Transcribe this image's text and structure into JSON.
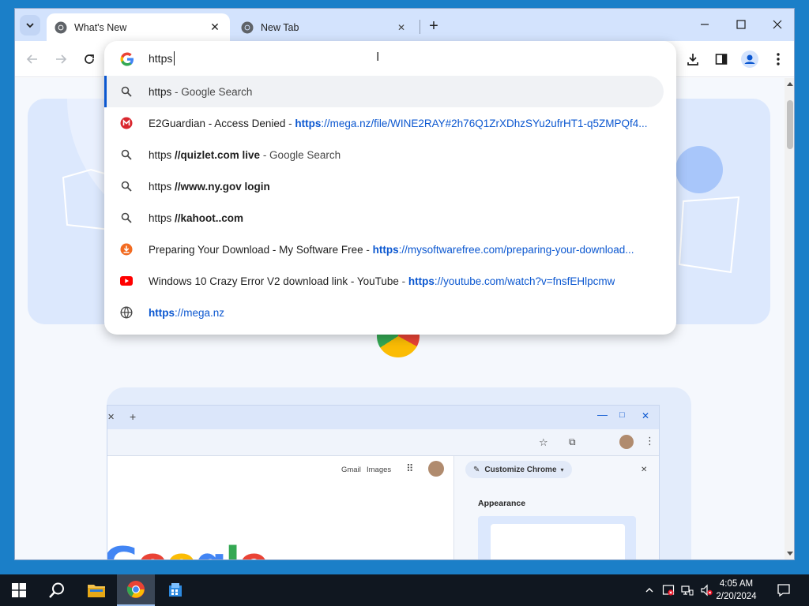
{
  "tabs": [
    {
      "title": "What's New",
      "active": true
    },
    {
      "title": "New Tab",
      "active": false
    }
  ],
  "omnibox": {
    "typed_text": "https",
    "suggestions": [
      {
        "icon": "search-icon",
        "parts": [
          {
            "t": "https",
            "c": ""
          },
          {
            "t": " - Google Search",
            "c": "dim"
          }
        ]
      },
      {
        "icon": "mega-favicon",
        "parts": [
          {
            "t": "E2Guardian - Access Denied",
            "c": ""
          },
          {
            "t": " - ",
            "c": "dim"
          },
          {
            "t": "https",
            "c": "url-b"
          },
          {
            "t": "://mega.nz/file/WINE2RAY#2h76Q1ZrXDhzSYu2ufrHT1-q5ZMPQf4...",
            "c": "url"
          }
        ]
      },
      {
        "icon": "search-icon",
        "parts": [
          {
            "t": "https ",
            "c": ""
          },
          {
            "t": "//quizlet.com live",
            "c": "bold"
          },
          {
            "t": " - Google Search",
            "c": "dim"
          }
        ]
      },
      {
        "icon": "search-icon",
        "parts": [
          {
            "t": "https ",
            "c": ""
          },
          {
            "t": "//www.ny.gov login",
            "c": "bold"
          }
        ]
      },
      {
        "icon": "search-icon",
        "parts": [
          {
            "t": "https ",
            "c": ""
          },
          {
            "t": "//kahoot..com",
            "c": "bold"
          }
        ]
      },
      {
        "icon": "download-favicon",
        "parts": [
          {
            "t": "Preparing Your Download - My Software Free",
            "c": ""
          },
          {
            "t": " - ",
            "c": "dim"
          },
          {
            "t": "https",
            "c": "url-b"
          },
          {
            "t": "://mysoftwarefree.com/preparing-your-download...",
            "c": "url"
          }
        ]
      },
      {
        "icon": "youtube-favicon",
        "parts": [
          {
            "t": "Windows 10 Crazy Error V2 download link - YouTube",
            "c": ""
          },
          {
            "t": " - ",
            "c": "dim"
          },
          {
            "t": "https",
            "c": "url-b"
          },
          {
            "t": "://youtube.com/watch?v=fnsfEHlpcmw",
            "c": "url"
          }
        ]
      },
      {
        "icon": "globe-icon",
        "parts": [
          {
            "t": "https",
            "c": "url-b"
          },
          {
            "t": "://mega.nz",
            "c": "url"
          }
        ]
      }
    ]
  },
  "mock_browser": {
    "gmail": "Gmail",
    "images": "Images",
    "customize": "Customize Chrome",
    "appearance": "Appearance",
    "google_word": "Google"
  },
  "taskbar": {
    "time": "4:05 AM",
    "date": "2/20/2024"
  },
  "colors": {
    "accent": "#0b57d0",
    "tabstrip": "#d3e3fd",
    "taskbar": "#101720"
  }
}
